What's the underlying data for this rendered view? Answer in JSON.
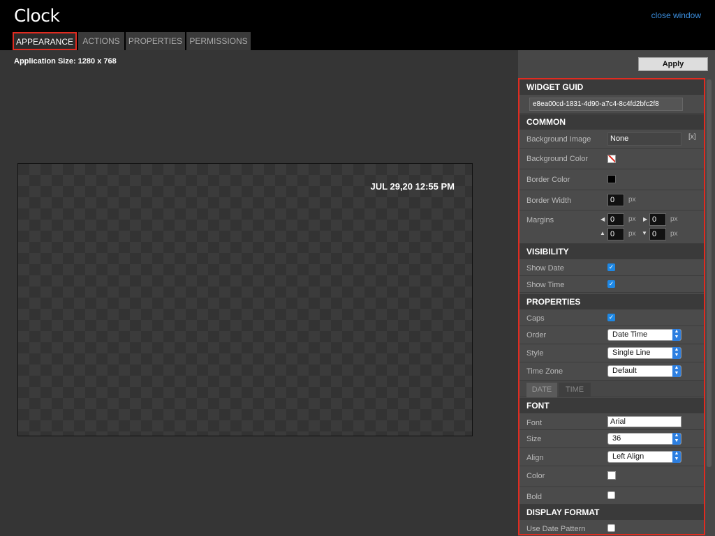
{
  "window": {
    "title": "Clock",
    "close_label": "close window"
  },
  "tabs": [
    "APPEARANCE",
    "ACTIONS",
    "PROPERTIES",
    "PERMISSIONS"
  ],
  "canvas": {
    "app_size": "Application Size: 1280 x 768",
    "clock_text": "JUL 29,20 12:55 PM"
  },
  "apply_label": "Apply",
  "panel": {
    "guid": {
      "header": "WIDGET GUID",
      "value": "e8ea00cd-1831-4d90-a7c4-8c4fd2bfc2f8"
    },
    "common": {
      "header": "COMMON",
      "bg_image_label": "Background Image",
      "bg_image_value": "None",
      "bg_image_clear": "[x]",
      "bg_color_label": "Background Color",
      "border_color_label": "Border Color",
      "border_width_label": "Border Width",
      "border_width": "0",
      "unit": "px",
      "margins_label": "Margins",
      "margin_left": "0",
      "margin_right": "0",
      "margin_top": "0",
      "margin_bottom": "0"
    },
    "visibility": {
      "header": "VISIBILITY",
      "show_date": "Show Date",
      "show_time": "Show Time"
    },
    "properties": {
      "header": "PROPERTIES",
      "caps": "Caps",
      "order_label": "Order",
      "order_value": "Date Time",
      "style_label": "Style",
      "style_value": "Single Line",
      "tz_label": "Time Zone",
      "tz_value": "Default",
      "subtab_date": "DATE",
      "subtab_time": "TIME"
    },
    "font": {
      "header": "FONT",
      "font_label": "Font",
      "font_value": "Arial",
      "size_label": "Size",
      "size_value": "36",
      "align_label": "Align",
      "align_value": "Left Align",
      "color_label": "Color",
      "bold_label": "Bold"
    },
    "display_format": {
      "header": "DISPLAY FORMAT",
      "use_pattern": "Use Date Pattern"
    }
  },
  "colors": {
    "accent": "#e02b20",
    "link": "#3b8fe0",
    "checkbox": "#1e88e5"
  }
}
